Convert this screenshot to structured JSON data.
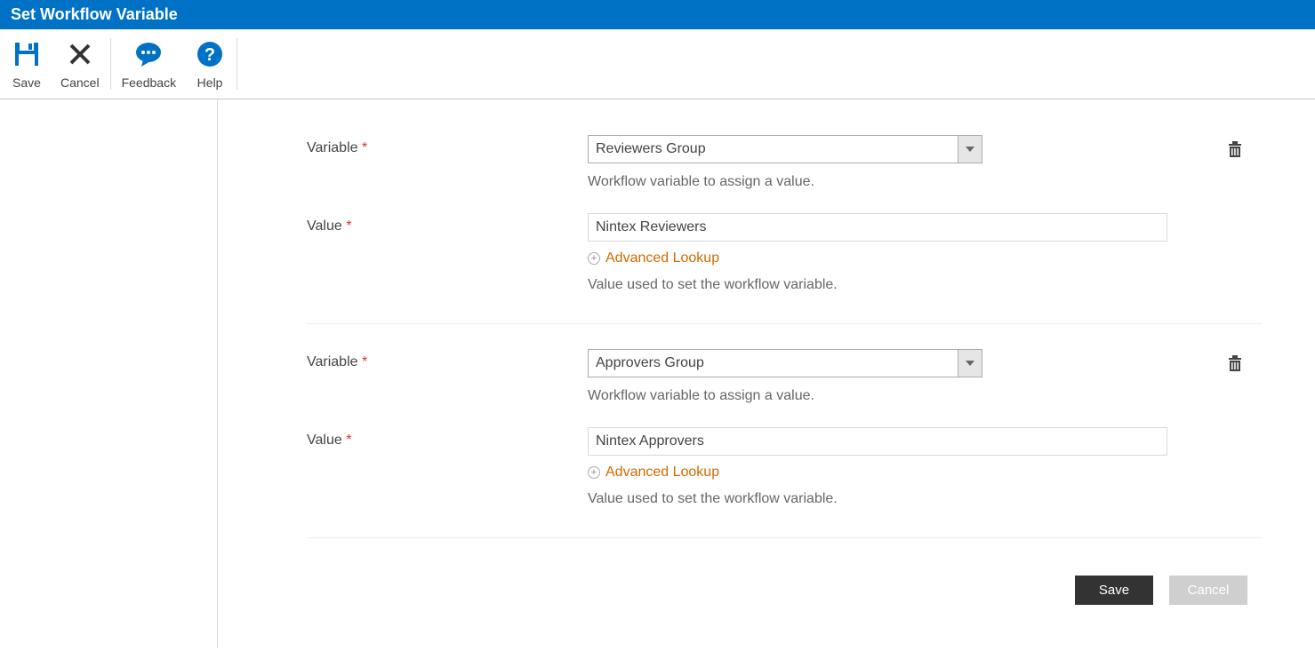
{
  "title": "Set Workflow Variable",
  "ribbon": {
    "save": "Save",
    "cancel": "Cancel",
    "feedback": "Feedback",
    "help": "Help"
  },
  "labels": {
    "variable": "Variable",
    "value": "Value",
    "variable_help": "Workflow variable to assign a value.",
    "value_help": "Value used to set the workflow variable.",
    "advanced_lookup": "Advanced Lookup"
  },
  "sections": [
    {
      "variable": "Reviewers Group",
      "value": "Nintex Reviewers"
    },
    {
      "variable": "Approvers Group",
      "value": "Nintex Approvers"
    }
  ],
  "footer": {
    "save": "Save",
    "cancel": "Cancel"
  }
}
